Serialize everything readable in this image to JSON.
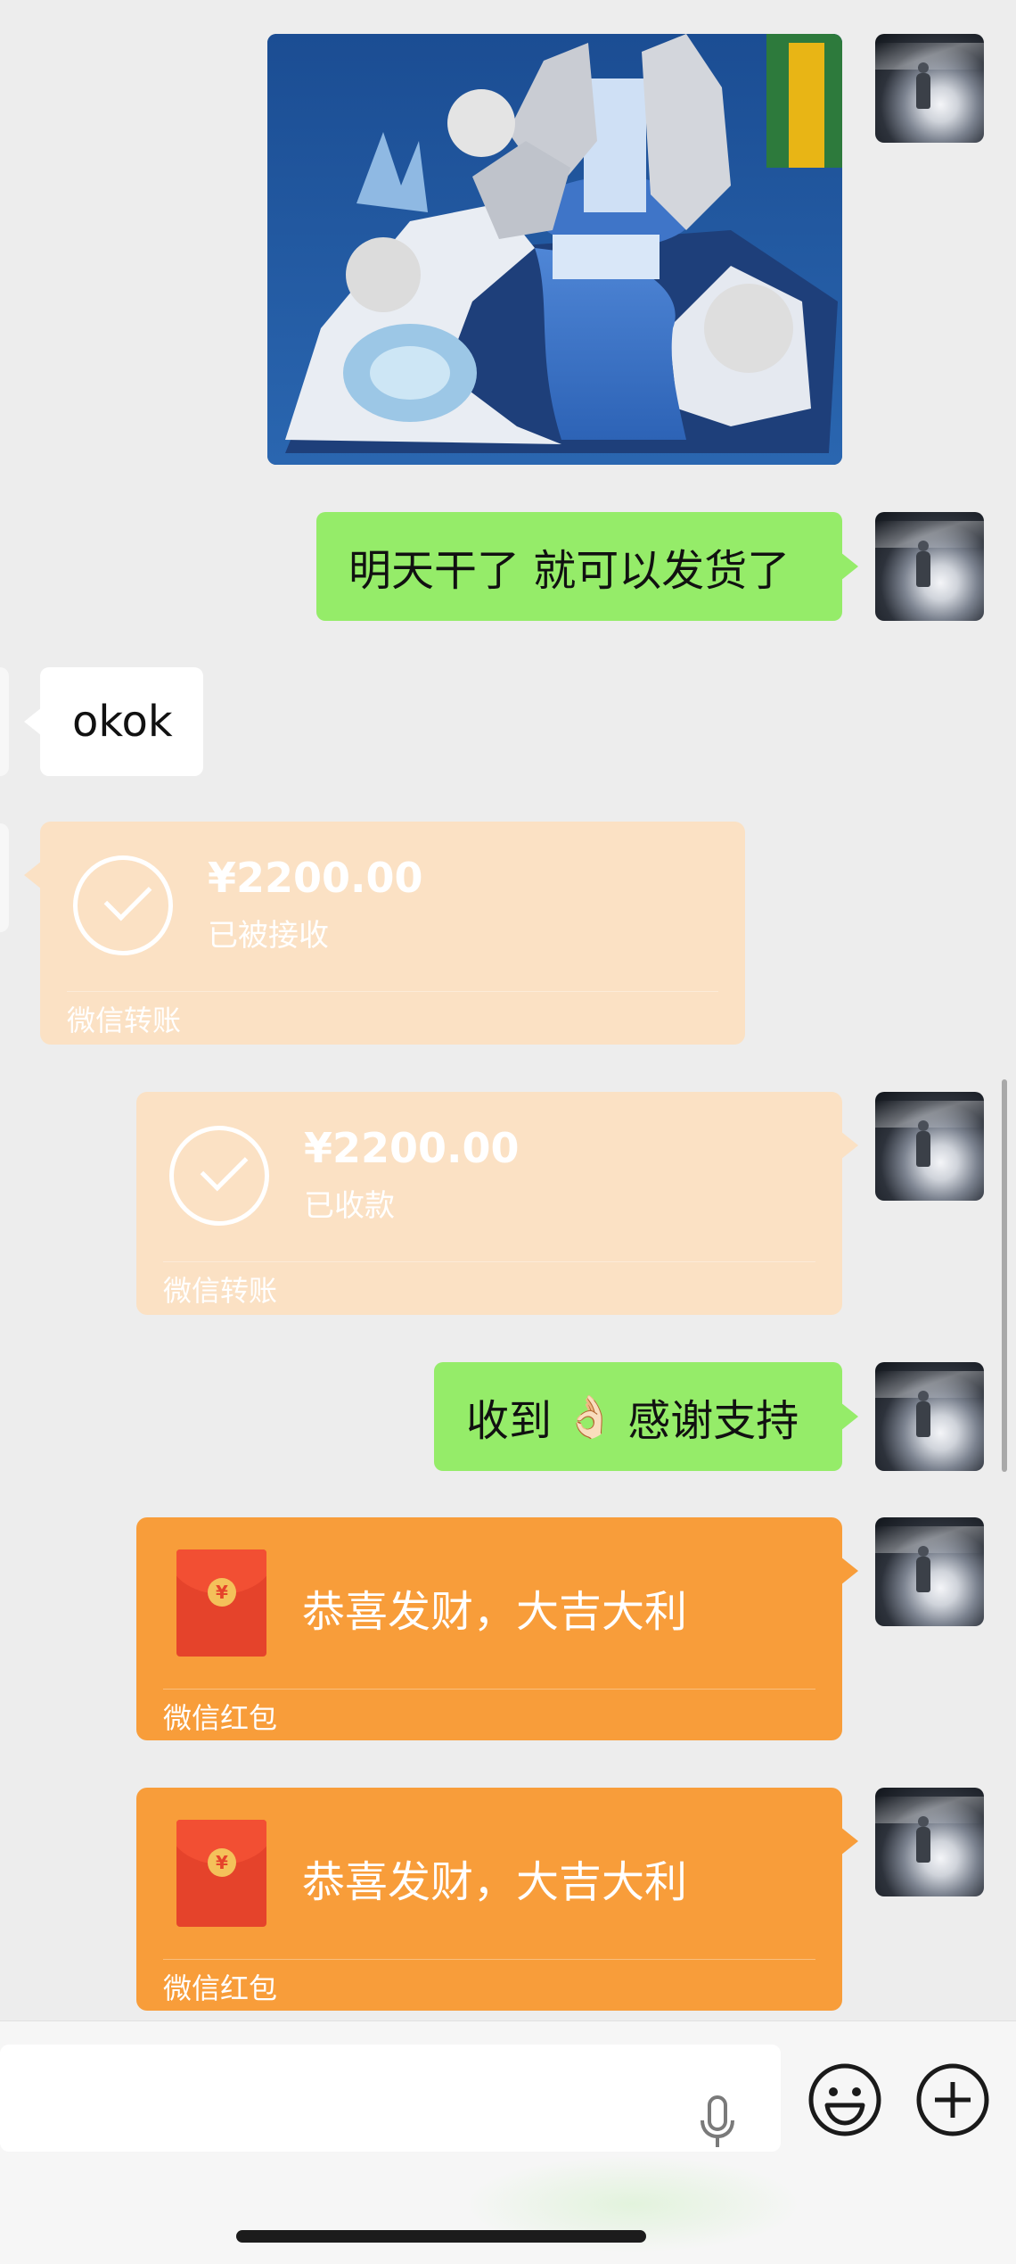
{
  "messages": {
    "sent_text_1": "明天干了 就可以发货了",
    "received_text_1": "okok",
    "transfer_received": {
      "amount": "¥2200.00",
      "status": "已被接收",
      "label": "微信转账"
    },
    "transfer_sent": {
      "amount": "¥2200.00",
      "status": "已收款",
      "label": "微信转账"
    },
    "sent_text_2_before": "收到",
    "sent_text_2_emoji": "👌🏻",
    "sent_text_2_after": "感谢支持",
    "red_packets": [
      {
        "title": "恭喜发财，大吉大利",
        "label": "微信红包",
        "coin": "¥"
      },
      {
        "title": "恭喜发财，大吉大利",
        "label": "微信红包",
        "coin": "¥"
      }
    ]
  },
  "input_bar": {
    "icons": [
      "microphone-icon",
      "emoji-icon",
      "plus-icon"
    ]
  },
  "colors": {
    "chat_background": "#ededed",
    "sent_bubble": "#95ec69",
    "received_bubble": "#ffffff",
    "transfer_card": "#fbe1c4",
    "red_packet_card": "#f89d3a"
  }
}
